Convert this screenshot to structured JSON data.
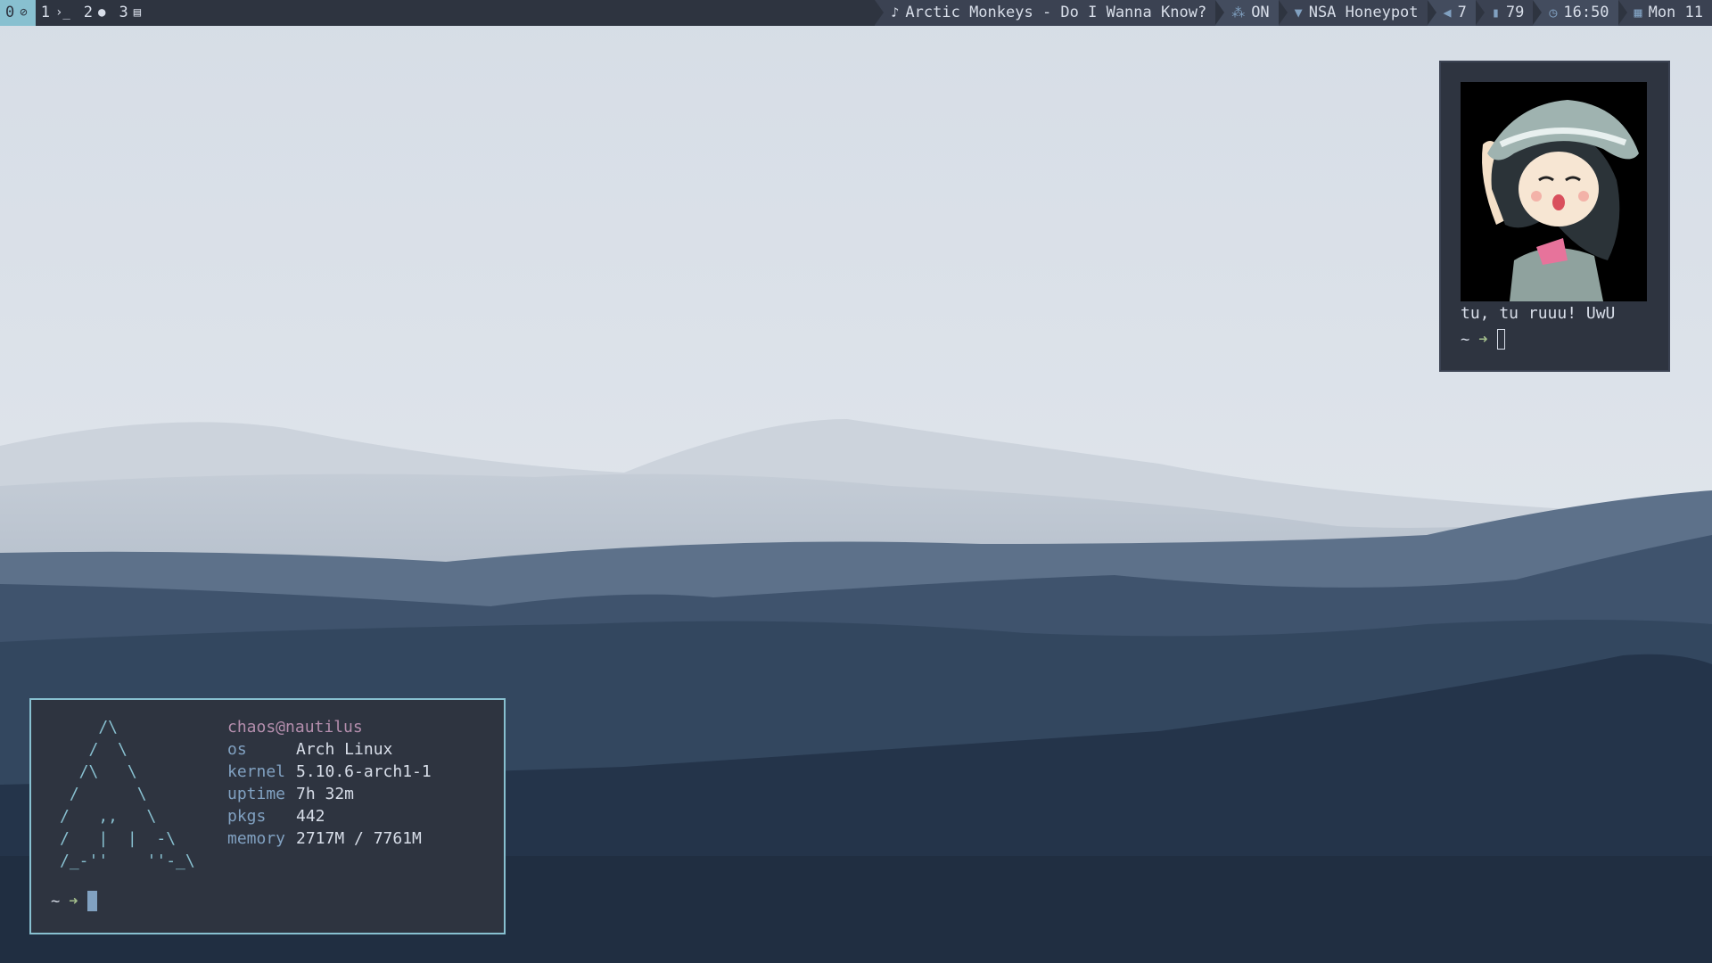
{
  "topbar": {
    "workspaces": [
      {
        "number": "0",
        "icon": "compass-icon",
        "active": true
      },
      {
        "number": "1",
        "icon": "terminal-icon",
        "active": false
      },
      {
        "number": "2",
        "icon": "firefox-icon",
        "active": false
      },
      {
        "number": "3",
        "icon": "file-icon",
        "active": false
      }
    ],
    "music": {
      "icon": "music-note-icon",
      "text": "Arctic Monkeys - Do I Wanna Know?"
    },
    "bluetooth": {
      "icon": "network-icon",
      "text": "ON"
    },
    "wifi": {
      "icon": "wifi-icon",
      "text": "NSA Honeypot"
    },
    "volume": {
      "icon": "volume-icon",
      "text": "7"
    },
    "battery": {
      "icon": "battery-icon",
      "text": "79"
    },
    "clock": {
      "icon": "clock-icon",
      "text": "16:50"
    },
    "date": {
      "icon": "calendar-icon",
      "text": "Mon 11"
    }
  },
  "fetch": {
    "ascii_art": "    /\\\n   /  \\\n  /\\   \\\n /      \\\n/   ,,   \\\n/   |  |  -\\\n/_-''    ''-_\\",
    "user_host": "chaos@nautilus",
    "rows": [
      {
        "key": "os",
        "value": "Arch Linux"
      },
      {
        "key": "kernel",
        "value": "5.10.6-arch1-1"
      },
      {
        "key": "uptime",
        "value": "7h 32m"
      },
      {
        "key": "pkgs",
        "value": "442"
      },
      {
        "key": "memory",
        "value": "2717M / 7761M"
      }
    ],
    "prompt_tilde": "~",
    "prompt_arrow": "➜"
  },
  "image_terminal": {
    "caption": "tu, tu ruuu! UwU",
    "prompt_tilde": "~",
    "prompt_arrow": "➜"
  },
  "colors": {
    "bar_bg": "#2e3440",
    "accent": "#88c0d0",
    "key": "#81a1c1",
    "user": "#b48ead",
    "arrow": "#a3be8c"
  }
}
